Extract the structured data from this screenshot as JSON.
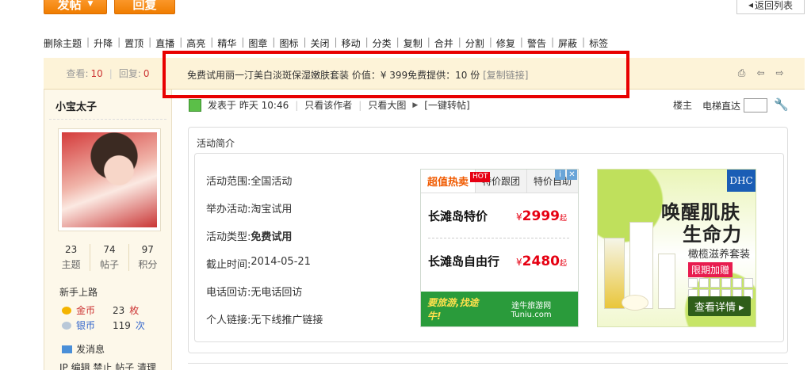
{
  "top": {
    "post_label": "发帖",
    "reply_label": "回复",
    "back_list_label": "返回列表"
  },
  "toolbar": [
    "删除主题",
    "升降",
    "置顶",
    "直播",
    "高亮",
    "精华",
    "图章",
    "图标",
    "关闭",
    "移动",
    "分类",
    "复制",
    "合并",
    "分割",
    "修复",
    "警告",
    "屏蔽",
    "标签"
  ],
  "stats": {
    "views_label": "查看:",
    "views": "10",
    "replies_label": "回复:",
    "replies": "0"
  },
  "thread": {
    "title": "免费试用丽一汀美白淡斑保湿嫩肤套装 价值：¥ 399免费提供：10 份",
    "copy_link": "[复制链接]"
  },
  "user": {
    "name": "小宝太子",
    "stats": [
      {
        "value": "23",
        "label": "主题"
      },
      {
        "value": "74",
        "label": "帖子"
      },
      {
        "value": "97",
        "label": "积分"
      }
    ],
    "group": "新手上路",
    "gold_label": "金币",
    "gold_value": "23",
    "gold_unit": "枚",
    "silver_label": "银币",
    "silver_value": "119",
    "silver_unit": "次",
    "send_msg": "发消息",
    "admin_links": "IP 编辑 禁止 帖子 清理"
  },
  "post": {
    "posted_label": "发表于 昨天 10:46",
    "only_author": "只看该作者",
    "only_image": "只看大图",
    "repost": "[一键转帖]",
    "floor": "楼主",
    "elevator": "电梯直达"
  },
  "activity": {
    "title": "活动简介",
    "rows": [
      {
        "key": "活动范围:",
        "value": "全国活动",
        "bold": false
      },
      {
        "key": "举办活动:",
        "value": "淘宝试用",
        "bold": false
      },
      {
        "key": "活动类型:",
        "value": "免费试用",
        "bold": true
      },
      {
        "key": "截止时间:",
        "value": "2014-05-21",
        "bold": false
      },
      {
        "key": "电话回访:",
        "value": "无电话回访",
        "bold": false
      },
      {
        "key": "个人链接:",
        "value": "无下线推广链接",
        "bold": false
      }
    ]
  },
  "ad1": {
    "tab_hot": "超值热卖",
    "hot_badge": "HOT",
    "tab_follow": "特价跟团",
    "tab_self": "特价自助",
    "deal1_name": "长滩岛特价",
    "deal1_currency": "¥",
    "deal1_price": "2999",
    "deal1_suffix": "起",
    "deal2_name": "长滩岛自由行",
    "deal2_currency": "¥",
    "deal2_price": "2480",
    "deal2_suffix": "起",
    "slogan": "要旅游,找途牛!",
    "logo": "途牛旅游网 Tuniu.com"
  },
  "ad2": {
    "brand": "DHC",
    "headline1": "唤醒肌肤",
    "headline2": "生命力",
    "sub": "橄榄滋养套装",
    "promo": "限期加赠",
    "cta": "查看详情 ▸"
  }
}
